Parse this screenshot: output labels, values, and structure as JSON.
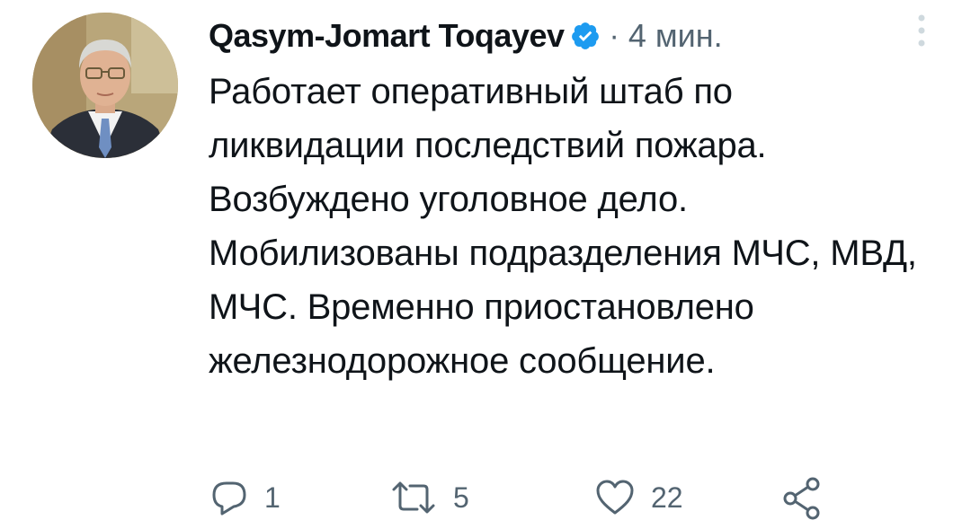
{
  "tweet": {
    "author_name": "Qasym-Jomart Toqayev",
    "separator": "·",
    "time": "4 мин.",
    "text": "Работает оперативный штаб по ликвидации последствий пожара. Возбуждено уголовное дело. Мобилизованы подразделения МЧС, МВД, МЧС. Временно приостановлено железнодорожное сообщение."
  },
  "actions": {
    "reply_count": "1",
    "retweet_count": "5",
    "like_count": "22"
  },
  "colors": {
    "text": "#0f1419",
    "secondary": "#536471",
    "verified": "#1d9bf0"
  },
  "icons": [
    "avatar",
    "verified-badge-icon",
    "more-options-icon",
    "reply-icon",
    "retweet-icon",
    "like-icon",
    "share-icon"
  ]
}
